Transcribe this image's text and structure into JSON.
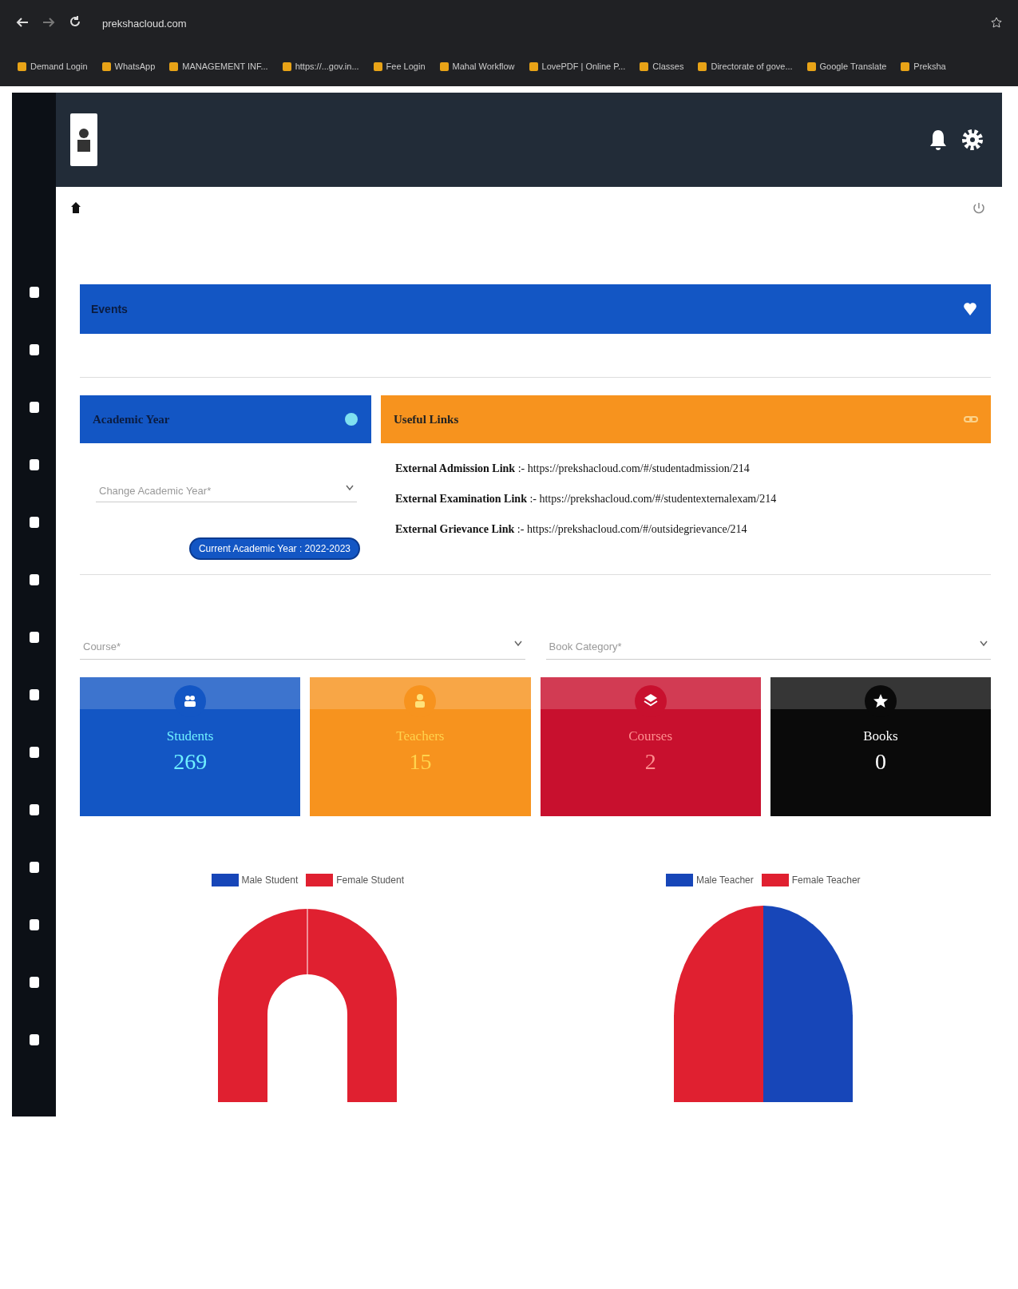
{
  "browser": {
    "url": "prekshacloud.com",
    "bookmarks": [
      "Demand Login",
      "WhatsApp",
      "MANAGEMENT INF...",
      "https://...gov.in...",
      "Fee Login",
      "Mahal Workflow",
      "LovePDF | Online P...",
      "Classes",
      "Directorate of gove...",
      "Google Translate",
      "Preksha"
    ]
  },
  "banner": {
    "title": "Events"
  },
  "academic_year": {
    "title": "Academic Year",
    "dropdown": {
      "placeholder": "Change Academic Year*"
    },
    "current_button": "Current Academic Year : 2022-2023"
  },
  "useful_links": {
    "title": "Useful Links",
    "links": [
      {
        "label": "External Admission Link",
        "url": ":- https://prekshacloud.com/#/studentadmission/214"
      },
      {
        "label": "External Examination Link",
        "url": ":- https://prekshacloud.com/#/studentexternalexam/214"
      },
      {
        "label": "External Grievance Link",
        "url": ":- https://prekshacloud.com/#/outsidegrievance/214"
      }
    ]
  },
  "filters": [
    {
      "placeholder": "Course*"
    },
    {
      "placeholder": "Book Category*"
    }
  ],
  "stats": [
    {
      "kind": "students",
      "label": "Students",
      "value": "269",
      "color": "#1356c4"
    },
    {
      "kind": "teachers",
      "label": "Teachers",
      "value": "15",
      "color": "#f7931e"
    },
    {
      "kind": "courses",
      "label": "Courses",
      "value": "2",
      "color": "#c8102e"
    },
    {
      "kind": "books",
      "label": "Books",
      "value": "0",
      "color": "#0a0a0a"
    }
  ],
  "charts": [
    {
      "kind": "student",
      "legend": [
        {
          "label": "Male Student",
          "color": "#1746b8"
        },
        {
          "label": "Female Student",
          "color": "#e02030"
        }
      ]
    },
    {
      "kind": "teacher",
      "legend": [
        {
          "label": "Male Teacher",
          "color": "#1746b8"
        },
        {
          "label": "Female Teacher",
          "color": "#e02030"
        }
      ]
    }
  ]
}
